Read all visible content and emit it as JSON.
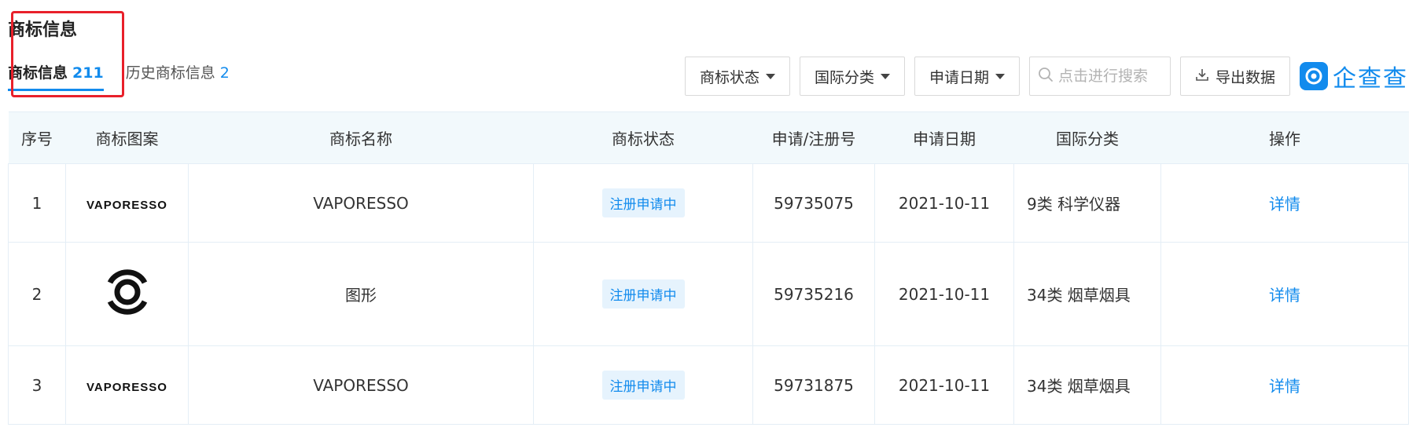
{
  "page": {
    "title": "商标信息"
  },
  "tabs": [
    {
      "label": "商标信息",
      "count": "211"
    },
    {
      "label": "历史商标信息",
      "count": "2"
    }
  ],
  "toolbar": {
    "status_filter": "商标状态",
    "class_filter": "国际分类",
    "date_filter": "申请日期",
    "search_placeholder": "点击进行搜索",
    "export_label": "导出数据",
    "brand_text": "企查查"
  },
  "table": {
    "headers": [
      "序号",
      "商标图案",
      "商标名称",
      "商标状态",
      "申请/注册号",
      "申请日期",
      "国际分类",
      "操作"
    ],
    "rows": [
      {
        "index": "1",
        "logo_text": "VAPORESSO",
        "name": "VAPORESSO",
        "status": "注册申请中",
        "reg_no": "59735075",
        "date": "2021-10-11",
        "class": "9类 科学仪器",
        "action": "详情"
      },
      {
        "index": "2",
        "logo_text": "",
        "name": "图形",
        "status": "注册申请中",
        "reg_no": "59735216",
        "date": "2021-10-11",
        "class": "34类 烟草烟具",
        "action": "详情"
      },
      {
        "index": "3",
        "logo_text": "VAPORESSO",
        "name": "VAPORESSO",
        "status": "注册申请中",
        "reg_no": "59731875",
        "date": "2021-10-11",
        "class": "34类 烟草烟具",
        "action": "详情"
      }
    ]
  },
  "colors": {
    "accent": "#128bed",
    "highlight_box": "#e8202a",
    "header_bg": "#f2f9fc",
    "badge_bg": "#e6f3fd"
  }
}
